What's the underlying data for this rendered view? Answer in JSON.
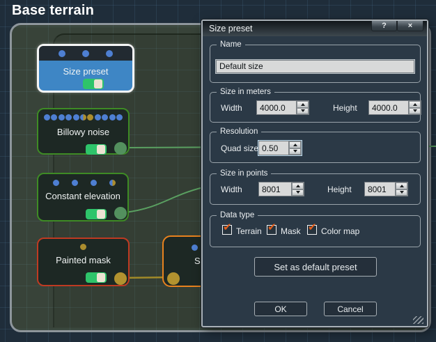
{
  "page": {
    "title": "Base terrain"
  },
  "graph": {
    "nodes": {
      "size_preset": {
        "label": "Size preset",
        "dots": [
          "blue",
          "blue",
          "blue"
        ],
        "toggle": "on"
      },
      "billowy_noise": {
        "label": "Billowy noise",
        "dots": [
          "blue",
          "blue",
          "blue",
          "blue",
          "blue",
          "half",
          "olive",
          "blue",
          "blue",
          "blue",
          "blue"
        ],
        "toggle": "on"
      },
      "constant_elevation": {
        "label": "Constant elevation",
        "dots": [
          "blue",
          "blue",
          "blue",
          "half"
        ],
        "toggle": "on"
      },
      "painted_mask": {
        "label": "Painted mask",
        "dots": [
          "olive"
        ],
        "toggle": "on"
      },
      "partial_node": {
        "label": "Sm",
        "dots": [
          "blue"
        ]
      }
    }
  },
  "dialog": {
    "title": "Size preset",
    "help_label": "?",
    "close_label": "×",
    "name_group": {
      "legend": "Name",
      "value": "Default size"
    },
    "size_meters": {
      "legend": "Size in meters",
      "width_label": "Width",
      "width_value": "4000.0",
      "height_label": "Height",
      "height_value": "4000.0"
    },
    "resolution": {
      "legend": "Resolution",
      "quad_label": "Quad size",
      "quad_value": "0.50"
    },
    "size_points": {
      "legend": "Size in points",
      "width_label": "Width",
      "width_value": "8001",
      "height_label": "Height",
      "height_value": "8001"
    },
    "data_type": {
      "legend": "Data type",
      "options": [
        "Terrain",
        "Mask",
        "Color map"
      ],
      "checked": [
        true,
        true,
        true
      ]
    },
    "buttons": {
      "set_default": "Set as default preset",
      "ok": "OK",
      "cancel": "Cancel"
    }
  },
  "colors": {
    "accent_blue_node": "#3e86c5",
    "green_node_border": "#3e8b25",
    "red_node_border": "#bf3a22",
    "orange_node_border": "#e8821e",
    "port_dot_blue": "#4e7fd2",
    "port_dot_olive": "#ab8d2e",
    "wire_green": "#5aa061",
    "wire_yellow": "#a18a28",
    "toggle_green": "#2ec46a",
    "check_orange": "#e8611c",
    "dialog_bg": "#2b3946",
    "canvas_bg": "#1f2d3a",
    "group_panel_fill": "#3a4439"
  }
}
